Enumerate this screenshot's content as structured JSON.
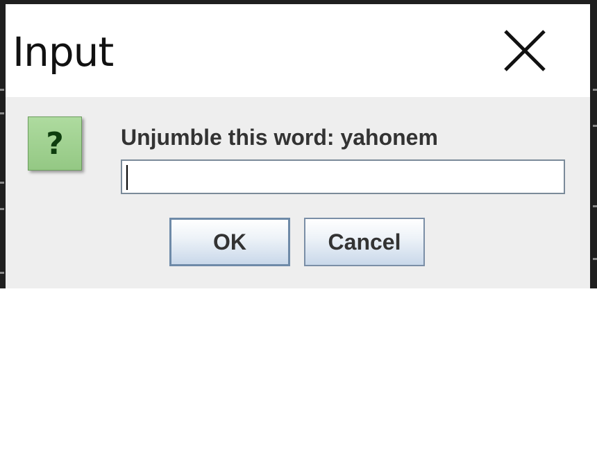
{
  "dialog": {
    "title": "Input",
    "close_icon": "close-icon",
    "message_icon": "question-icon",
    "message_icon_glyph": "?",
    "prompt": "Unjumble this word: yahonem",
    "input_value": "",
    "ok_label": "OK",
    "cancel_label": "Cancel"
  },
  "colors": {
    "title_bar": "#ffffff",
    "content_bg": "#eeeeee",
    "icon_green": "#a3d193",
    "button_border": "#7a8ea6"
  }
}
